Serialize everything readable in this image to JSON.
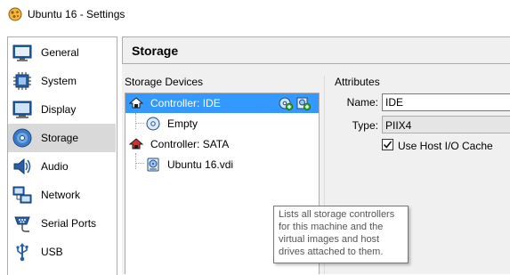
{
  "window": {
    "title": "Ubuntu 16 - Settings"
  },
  "sidebar": {
    "items": [
      {
        "label": "General",
        "icon": "general-icon",
        "selected": false
      },
      {
        "label": "System",
        "icon": "system-icon",
        "selected": false
      },
      {
        "label": "Display",
        "icon": "display-icon",
        "selected": false
      },
      {
        "label": "Storage",
        "icon": "storage-icon",
        "selected": true
      },
      {
        "label": "Audio",
        "icon": "audio-icon",
        "selected": false
      },
      {
        "label": "Network",
        "icon": "network-icon",
        "selected": false
      },
      {
        "label": "Serial Ports",
        "icon": "serial-ports-icon",
        "selected": false
      },
      {
        "label": "USB",
        "icon": "usb-icon",
        "selected": false
      }
    ]
  },
  "main": {
    "title": "Storage",
    "devices_label": "Storage Devices",
    "attributes_label": "Attributes",
    "tree": [
      {
        "label": "Controller: IDE",
        "icon": "ide-controller-icon",
        "selected": true
      },
      {
        "label": "Empty",
        "icon": "optical-disc-icon",
        "selected": false
      },
      {
        "label": "Controller: SATA",
        "icon": "sata-controller-icon",
        "selected": false
      },
      {
        "label": "Ubuntu 16.vdi",
        "icon": "hard-disk-icon",
        "selected": false
      }
    ],
    "attributes": {
      "name_label": "Name:",
      "name_value": "IDE",
      "type_label": "Type:",
      "type_value": "PIIX4",
      "cache_label": "Use Host I/O Cache",
      "cache_checked": true
    },
    "tooltip": {
      "lines": [
        "Lists all storage controllers",
        "for this machine and the",
        "virtual images and host",
        "drives attached to them."
      ]
    }
  },
  "colors": {
    "selection": "#3399ff",
    "sidebar_selected": "#d9d9d9",
    "panel_bg": "#f0f0f0"
  }
}
